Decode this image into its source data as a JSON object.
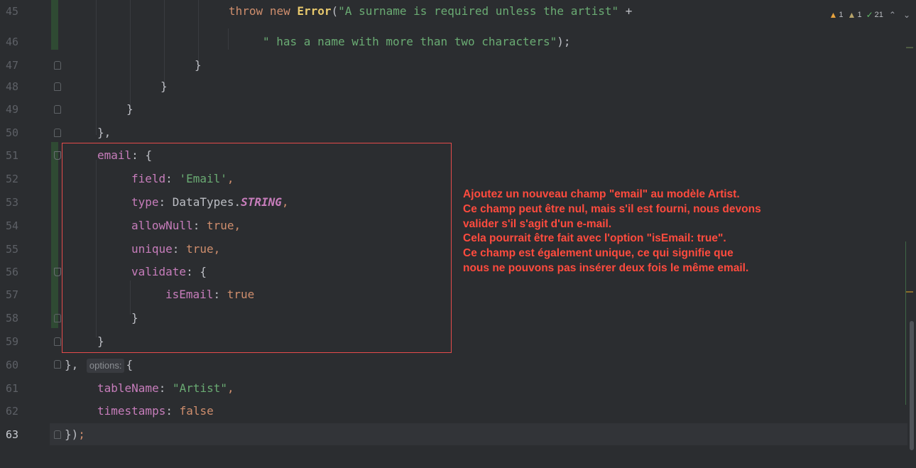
{
  "editor": {
    "current_line": 63,
    "line_numbers": [
      "45",
      "46",
      "47",
      "48",
      "49",
      "50",
      "51",
      "52",
      "53",
      "54",
      "55",
      "56",
      "57",
      "58",
      "59",
      "60",
      "61",
      "62",
      "63"
    ],
    "code": {
      "l45_a": "throw",
      "l45_b": "new",
      "l45_c": "Error",
      "l45_d": "(",
      "l45_e": "\"A surname is required unless the artist\"",
      "l45_f": "+",
      "l46_a": "\" has a name with more than two characters\"",
      "l46_b": ");",
      "brace_close": "}",
      "l50": "},",
      "l51_key": "email",
      "l51_rest": ": {",
      "l52_key": "field",
      "l52_colon": ": ",
      "l52_val": "'Email'",
      "l52_comma": ",",
      "l53_key": "type",
      "l53_colon": ": ",
      "l53_cls": "DataTypes.",
      "l53_static": "STRING",
      "l53_comma": ",",
      "l54_key": "allowNull",
      "l54_colon": ": ",
      "l54_val": "true",
      "l54_comma": ",",
      "l55_key": "unique",
      "l55_colon": ": ",
      "l55_val": "true",
      "l55_comma": ",",
      "l56_key": "validate",
      "l56_rest": ": {",
      "l57_key": "isEmail",
      "l57_colon": ": ",
      "l57_val": "true",
      "l60_a": "},",
      "l60_hint": "options:",
      "l60_b": "{",
      "l61_key": "tableName",
      "l61_colon": ": ",
      "l61_val": "\"Artist\"",
      "l61_comma": ",",
      "l62_key": "timestamps",
      "l62_colon": ": ",
      "l62_val": "false",
      "l63_a": "})",
      "l63_b": ";"
    }
  },
  "inspection": {
    "warnings": "1",
    "weak_warnings": "1",
    "ok_count": "21",
    "warn_icon": "warning-triangle-icon",
    "weak_icon": "weak-warning-triangle-icon",
    "ok_icon": "checkmark-icon"
  },
  "annotation": {
    "lines": [
      "Ajoutez un nouveau champ \"email\" au modèle Artist.",
      "Ce champ peut être nul, mais s'il est fourni, nous devons",
      "valider s'il s'agit d'un e-mail.",
      "Cela pourrait être fait avec l'option \"isEmail: true\".",
      "Ce champ est également unique, ce qui signifie que",
      "nous ne pouvons pas insérer deux fois le même email."
    ],
    "color": "#ff4b3e"
  },
  "colors": {
    "background": "#2b2d30",
    "keyword": "#cf8e6d",
    "string": "#6aab73",
    "property": "#c77dbb",
    "highlight_box": "#e54b4b"
  }
}
